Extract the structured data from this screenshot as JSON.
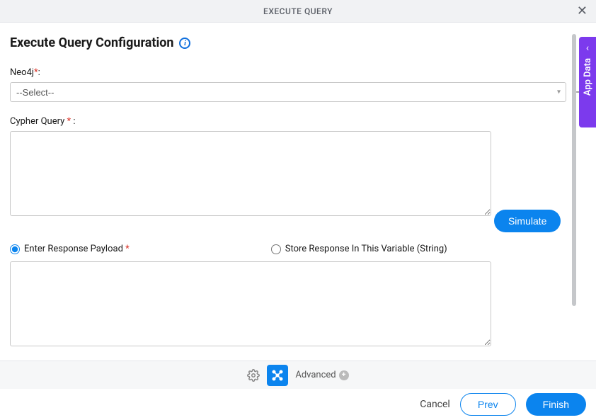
{
  "header": {
    "title": "EXECUTE QUERY"
  },
  "page": {
    "title": "Execute Query Configuration"
  },
  "fields": {
    "neo4j": {
      "label": "Neo4j",
      "required_mark": "*",
      "colon": ":",
      "placeholder": "--Select--"
    },
    "cypher": {
      "label": "Cypher Query ",
      "required_mark": "*",
      "colon": " :"
    },
    "simulate_label": "Simulate",
    "radio1": {
      "label": "Enter Response Payload ",
      "required_mark": "*"
    },
    "radio2": {
      "label": "Store Response In This Variable (String)"
    }
  },
  "toolbar": {
    "advanced_label": "Advanced"
  },
  "footer": {
    "cancel": "Cancel",
    "prev": "Prev",
    "finish": "Finish"
  },
  "side_tab": {
    "label": "App Data"
  }
}
